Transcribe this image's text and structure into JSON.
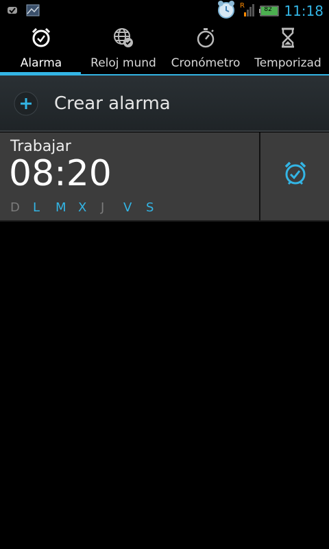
{
  "status_bar": {
    "time": "11:18",
    "battery_percent": "82",
    "roaming_indicator": "R",
    "icons": [
      "check-notification-icon",
      "image-notification-icon",
      "alarm-clock-status-icon",
      "signal-icon",
      "battery-icon"
    ]
  },
  "tabs": [
    {
      "label": "Alarma",
      "icon": "alarm-clock-icon",
      "active": true
    },
    {
      "label": "Reloj mund",
      "icon": "world-clock-icon",
      "active": false
    },
    {
      "label": "Cronómetro",
      "icon": "stopwatch-icon",
      "active": false
    },
    {
      "label": "Temporizad",
      "icon": "hourglass-icon",
      "active": false
    }
  ],
  "create_alarm": {
    "label": "Crear alarma",
    "icon": "plus-icon"
  },
  "alarms": [
    {
      "name": "Trabajar",
      "time": "08:20",
      "days": [
        {
          "letter": "D",
          "active": false
        },
        {
          "letter": "L",
          "active": true
        },
        {
          "letter": "M",
          "active": true
        },
        {
          "letter": "X",
          "active": true
        },
        {
          "letter": "J",
          "active": false
        },
        {
          "letter": "V",
          "active": true
        },
        {
          "letter": "S",
          "active": true
        }
      ],
      "enabled": true
    }
  ],
  "colors": {
    "accent": "#33b5e5",
    "background": "#000000",
    "row_background": "#3c3c3c",
    "inactive_day": "#7c7c7c"
  }
}
